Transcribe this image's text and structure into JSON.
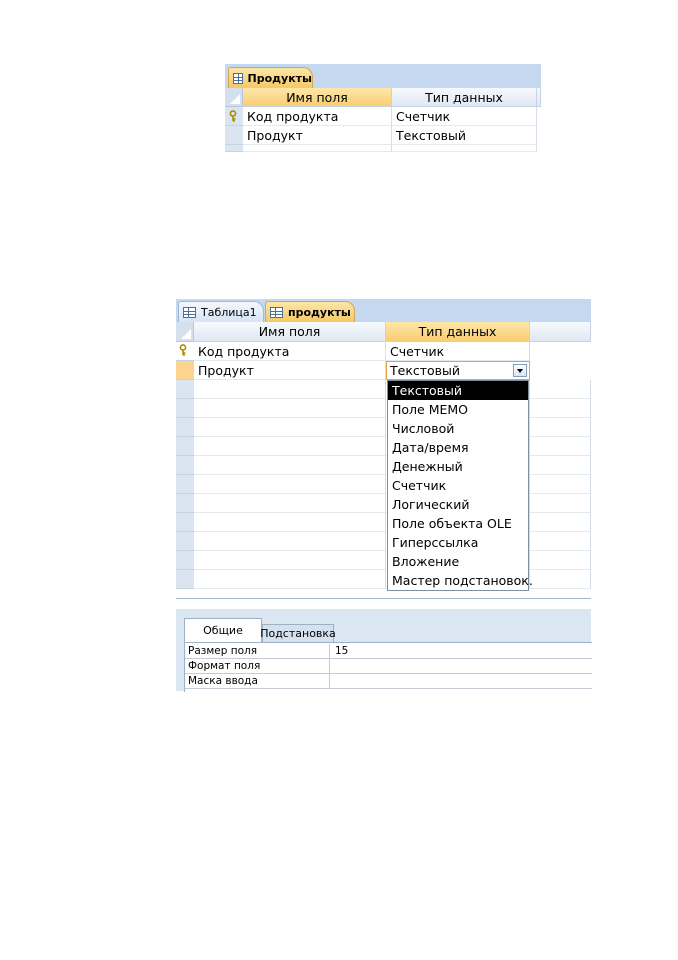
{
  "small_table": {
    "tab_label": "Продукты",
    "headers": [
      "Имя поля",
      "Тип данных"
    ],
    "rows": [
      {
        "field": "Код продукта",
        "type": "Счетчик",
        "primary_key": true
      },
      {
        "field": "Продукт",
        "type": "Текстовый",
        "primary_key": false
      }
    ]
  },
  "large_table": {
    "tabs": [
      "Таблица1",
      "продукты"
    ],
    "headers": [
      "Имя поля",
      "Тип данных"
    ],
    "rows": [
      {
        "field": "Код продукта",
        "type": "Счетчик",
        "primary_key": true
      },
      {
        "field": "Продукт",
        "type": "Текстовый",
        "primary_key": false
      }
    ],
    "type_options": [
      "Текстовый",
      "Поле MEMO",
      "Числовой",
      "Дата/время",
      "Денежный",
      "Счетчик",
      "Логический",
      "Поле объекта OLE",
      "Гиперссылка",
      "Вложение",
      "Мастер подстановок."
    ],
    "selected_option": "Текстовый"
  },
  "properties": {
    "tabs": [
      "Общие",
      "Подстановка"
    ],
    "rows": [
      {
        "label": "Размер поля",
        "value": "15"
      },
      {
        "label": "Формат поля",
        "value": ""
      },
      {
        "label": "Маска ввода",
        "value": ""
      }
    ]
  },
  "colors": {
    "active_tab": "#f7c865",
    "tabstrip": "#c4d8ef",
    "selection": "#000000"
  },
  "icons": [
    "table-icon",
    "primary-key-icon",
    "dropdown-arrow-icon"
  ]
}
